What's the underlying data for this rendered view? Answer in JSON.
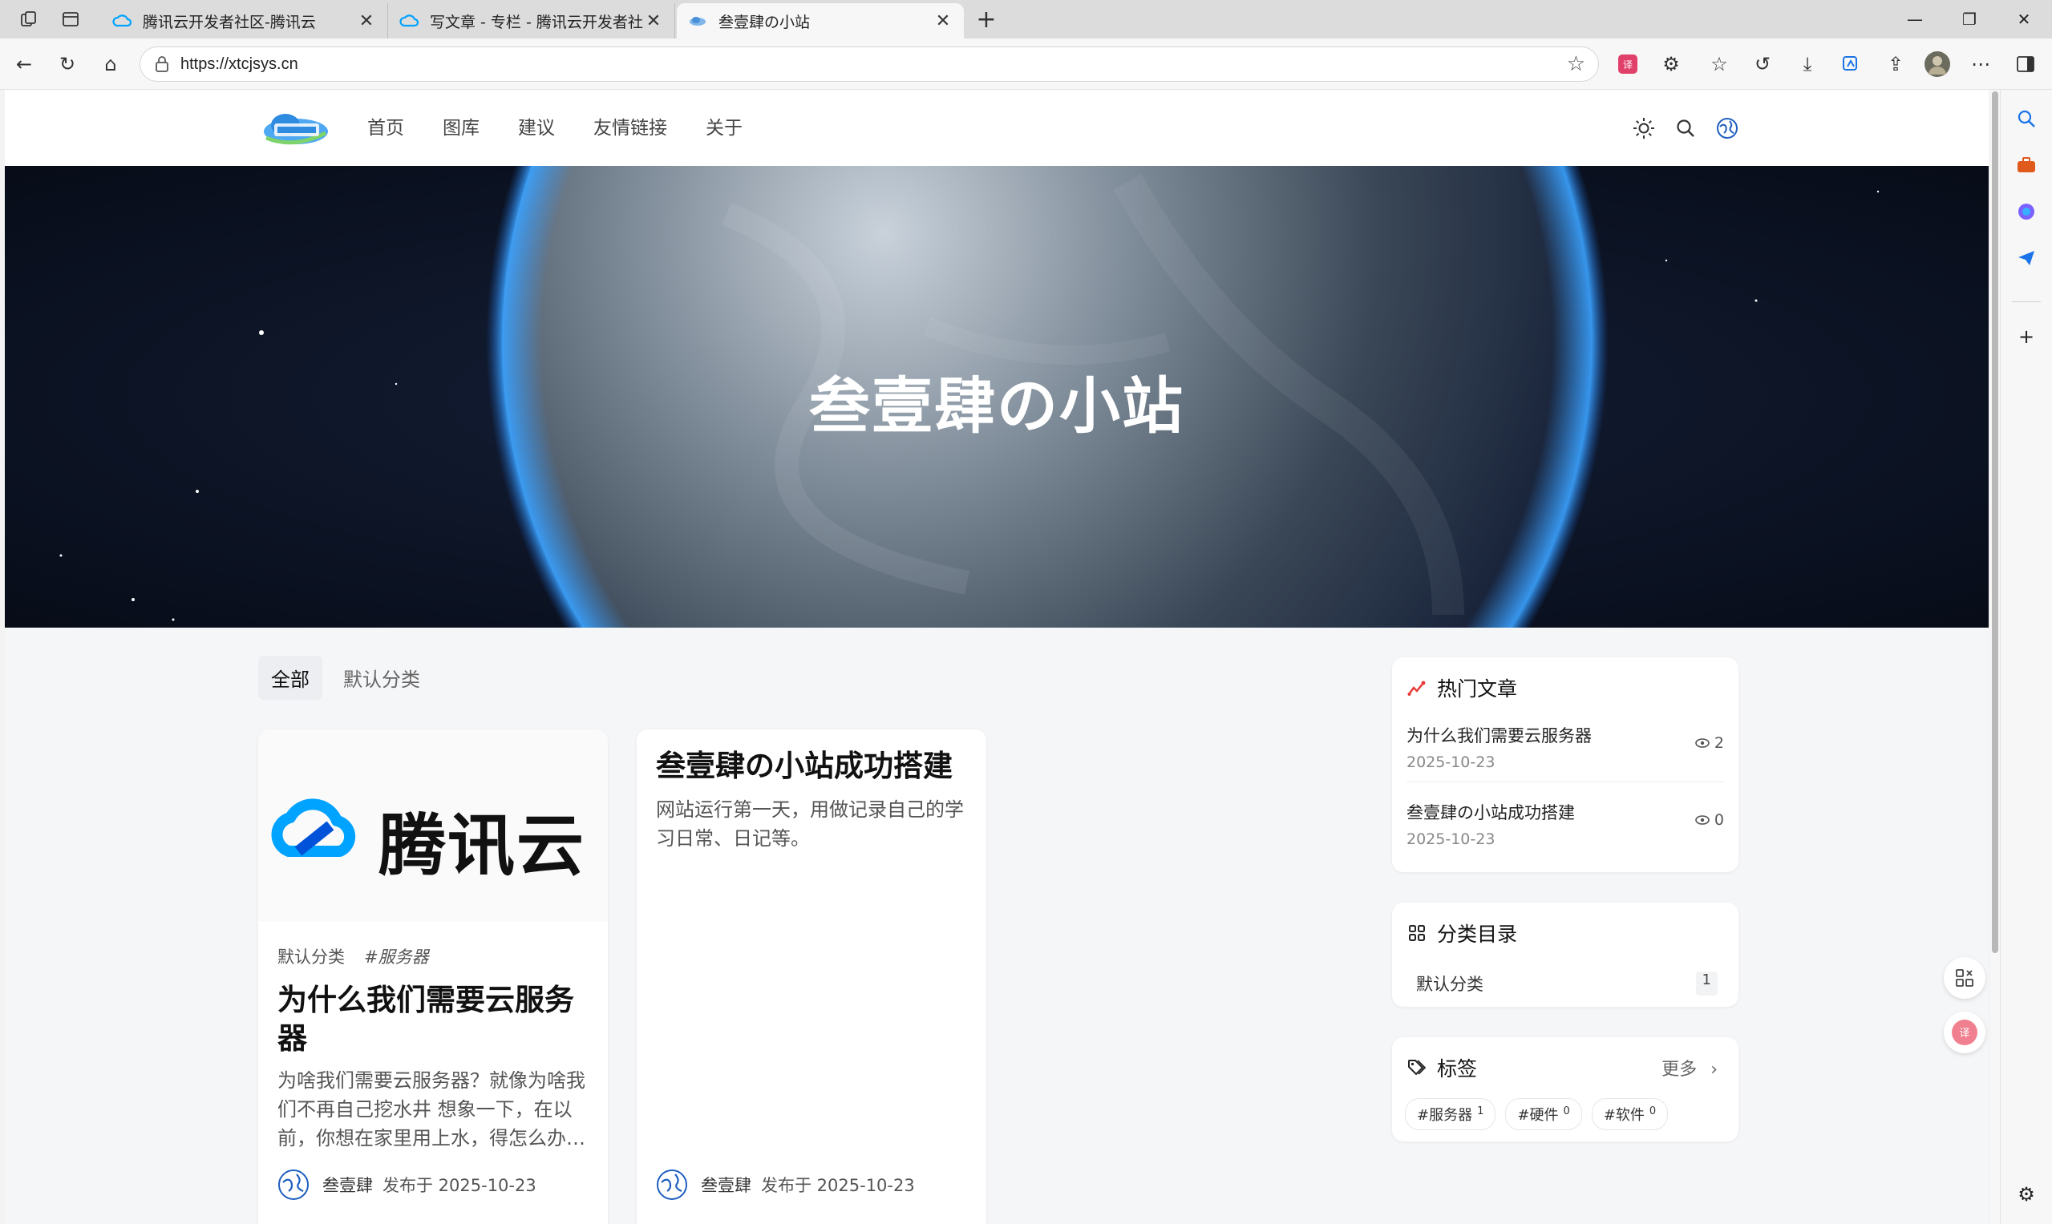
{
  "browser": {
    "tabs": [
      {
        "title": "腾讯云开发者社区-腾讯云",
        "active": false
      },
      {
        "title": "写文章 - 专栏 - 腾讯云开发者社区",
        "active": false
      },
      {
        "title": "叁壹肆の小站",
        "active": true
      }
    ],
    "url": "https://xtcjsys.cn"
  },
  "site": {
    "nav": [
      "首页",
      "图库",
      "建议",
      "友情链接",
      "关于"
    ],
    "hero_title": "叁壹肆の小站",
    "categories": [
      "全部",
      "默认分类"
    ],
    "posts": [
      {
        "cover_text": "腾讯云",
        "category": "默认分类",
        "tag": "#服务器",
        "title": "为什么我们需要云服务器",
        "excerpt": "为啥我们需要云服务器？就像为啥我们不再自己挖水井 想象一下，在以前，你想在家里用上水，得怎么办…",
        "author": "叁壹肆",
        "published": "发布于 2025-10-23"
      },
      {
        "title": "叁壹肆の小站成功搭建",
        "excerpt": "网站运行第一天，用做记录自己的学习日常、日记等。",
        "author": "叁壹肆",
        "published": "发布于 2025-10-23"
      }
    ],
    "hot": {
      "heading": "热门文章",
      "items": [
        {
          "title": "为什么我们需要云服务器",
          "date": "2025-10-23",
          "views": "2"
        },
        {
          "title": "叁壹肆の小站成功搭建",
          "date": "2025-10-23",
          "views": "0"
        }
      ]
    },
    "category_widget": {
      "heading": "分类目录",
      "items": [
        {
          "name": "默认分类",
          "count": "1"
        }
      ]
    },
    "tags_widget": {
      "heading": "标签",
      "more": "更多",
      "tags": [
        {
          "name": "#服务器",
          "count": "1"
        },
        {
          "name": "#硬件",
          "count": "0"
        },
        {
          "name": "#软件",
          "count": "0"
        }
      ]
    }
  },
  "colors": {
    "brand_blue": "#0052d9",
    "cloud_cyan": "#00a3ff",
    "hot_red": "#e53935"
  }
}
